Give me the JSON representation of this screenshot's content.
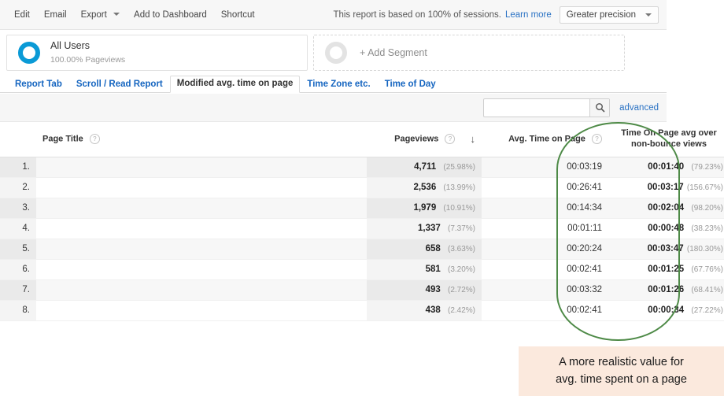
{
  "toolbar": {
    "actions": [
      {
        "label": "Edit",
        "has_caret": false
      },
      {
        "label": "Email",
        "has_caret": false
      },
      {
        "label": "Export",
        "has_caret": true
      },
      {
        "label": "Add to Dashboard",
        "has_caret": false
      },
      {
        "label": "Shortcut",
        "has_caret": false
      }
    ],
    "sampling_note": "This report is based on 100% of sessions.",
    "learn_more": "Learn more",
    "precision_label": "Greater precision"
  },
  "segments": {
    "all_users": {
      "title": "All Users",
      "subtitle": "100.00% Pageviews",
      "donut_color": "#0a9ad6"
    },
    "add_segment_label": "+ Add Segment"
  },
  "tabs": [
    {
      "label": "Report Tab",
      "active": false
    },
    {
      "label": "Scroll / Read Report",
      "active": false
    },
    {
      "label": "Modified avg. time on page",
      "active": true
    },
    {
      "label": "Time Zone etc.",
      "active": false
    },
    {
      "label": "Time of Day",
      "active": false
    }
  ],
  "search": {
    "value": "",
    "placeholder": "",
    "advanced_label": "advanced"
  },
  "table": {
    "columns": {
      "index": "",
      "page_title": "Page Title",
      "pageviews": "Pageviews",
      "avg_time_on_page": "Avg. Time on Page",
      "time_on_page_nonbounce": "Time On Page avg over non-bounce views"
    },
    "sort_indicator": "↓",
    "help_icon": "?",
    "rows": [
      {
        "index": "1.",
        "page_title": "",
        "pageviews": "4,711",
        "pageviews_pct": "(25.98%)",
        "avg_time_on_page": "00:03:19",
        "time_nonbounce": "00:01:40",
        "time_nonbounce_pct": "(79.23%)"
      },
      {
        "index": "2.",
        "page_title": "",
        "pageviews": "2,536",
        "pageviews_pct": "(13.99%)",
        "avg_time_on_page": "00:26:41",
        "time_nonbounce": "00:03:17",
        "time_nonbounce_pct": "(156.67%)"
      },
      {
        "index": "3.",
        "page_title": "",
        "pageviews": "1,979",
        "pageviews_pct": "(10.91%)",
        "avg_time_on_page": "00:14:34",
        "time_nonbounce": "00:02:04",
        "time_nonbounce_pct": "(98.20%)"
      },
      {
        "index": "4.",
        "page_title": "",
        "pageviews": "1,337",
        "pageviews_pct": "(7.37%)",
        "avg_time_on_page": "00:01:11",
        "time_nonbounce": "00:00:48",
        "time_nonbounce_pct": "(38.23%)"
      },
      {
        "index": "5.",
        "page_title": "",
        "pageviews": "658",
        "pageviews_pct": "(3.63%)",
        "avg_time_on_page": "00:20:24",
        "time_nonbounce": "00:03:47",
        "time_nonbounce_pct": "(180.30%)"
      },
      {
        "index": "6.",
        "page_title": "",
        "pageviews": "581",
        "pageviews_pct": "(3.20%)",
        "avg_time_on_page": "00:02:41",
        "time_nonbounce": "00:01:25",
        "time_nonbounce_pct": "(67.76%)"
      },
      {
        "index": "7.",
        "page_title": "",
        "pageviews": "493",
        "pageviews_pct": "(2.72%)",
        "avg_time_on_page": "00:03:32",
        "time_nonbounce": "00:01:26",
        "time_nonbounce_pct": "(68.41%)"
      },
      {
        "index": "8.",
        "page_title": "",
        "pageviews": "438",
        "pageviews_pct": "(2.42%)",
        "avg_time_on_page": "00:02:41",
        "time_nonbounce": "00:00:34",
        "time_nonbounce_pct": "(27.22%)"
      }
    ]
  },
  "annotation": {
    "line1": "A more realistic value for",
    "line2": "avg. time spent on a page",
    "background_color": "#fbe9dd",
    "highlight_color": "#4e8a47"
  }
}
